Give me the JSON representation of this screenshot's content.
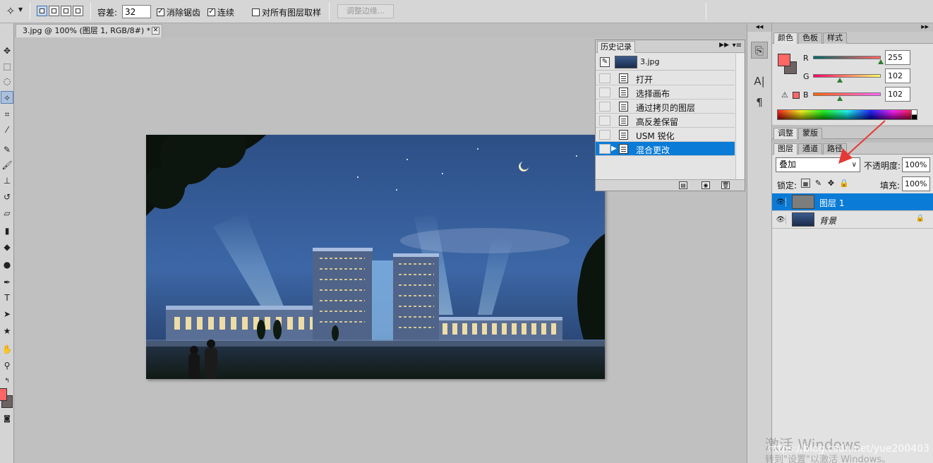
{
  "options_bar": {
    "tolerance_label": "容差:",
    "tolerance_value": "32",
    "anti_alias_label": "消除锯齿",
    "anti_alias_checked": true,
    "contiguous_label": "连续",
    "contiguous_checked": true,
    "sample_all_layers_label": "对所有图层取样",
    "sample_all_layers_checked": false,
    "refine_edge_label": "调整边缘..."
  },
  "document": {
    "tab_title": "3.jpg @ 100% (图层 1, RGB/8#) *"
  },
  "history": {
    "tab_label": "历史记录",
    "snapshot_label": "3.jpg",
    "items": [
      {
        "label": "打开"
      },
      {
        "label": "选择画布"
      },
      {
        "label": "通过拷贝的图层"
      },
      {
        "label": "高反差保留"
      },
      {
        "label": "USM 锐化"
      },
      {
        "label": "混合更改",
        "selected": true
      }
    ]
  },
  "color_panel": {
    "tabs": [
      "颜色",
      "色板",
      "样式"
    ],
    "active_tab": 0,
    "channels": [
      {
        "label": "R",
        "value": "255",
        "fraction": 1.0
      },
      {
        "label": "G",
        "value": "102",
        "fraction": 0.4
      },
      {
        "label": "B",
        "value": "102",
        "fraction": 0.4
      }
    ],
    "foreground_color": "#ff6666",
    "background_color": "#6e6262"
  },
  "adjust_tabs": [
    "调整",
    "蒙版"
  ],
  "layers_panel": {
    "tabs": [
      "图层",
      "通道",
      "路径"
    ],
    "active_tab": 0,
    "blend_mode": "叠加",
    "opacity_label": "不透明度:",
    "opacity_value": "100%",
    "lock_label": "锁定:",
    "fill_label": "填充:",
    "fill_value": "100%",
    "layers": [
      {
        "name": "图层 1",
        "selected": true
      },
      {
        "name": "背景",
        "selected": false
      }
    ]
  },
  "watermark": {
    "line1": "激活 Windows",
    "line2": "转到\"设置\"以激活 Windows。",
    "credit": "https://blog.csdn.net/yue200403"
  },
  "colors": {
    "selection_blue": "#0a7bd6",
    "annotation_red": "#e53935"
  }
}
